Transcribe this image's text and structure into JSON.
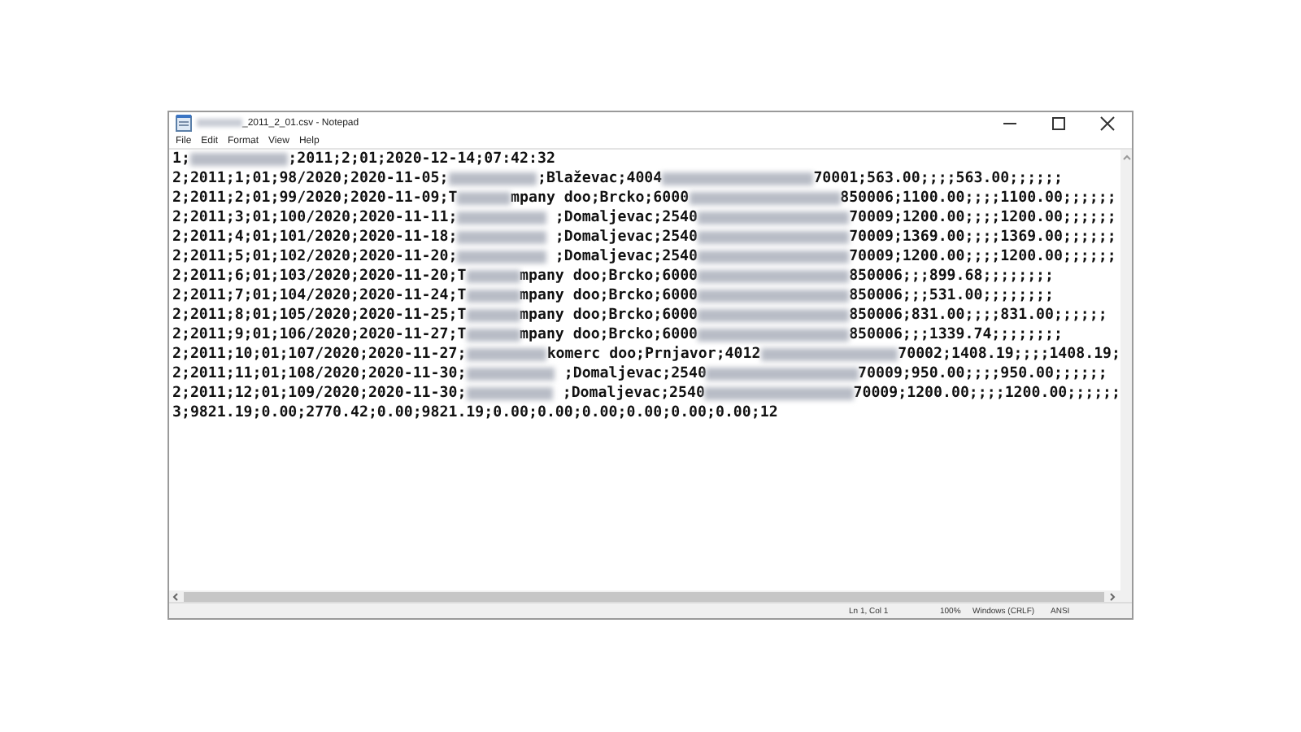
{
  "window": {
    "title_hidden_prefix": true,
    "title": "_2011_2_01.csv - Notepad"
  },
  "menu": [
    "File",
    "Edit",
    "Format",
    "View",
    "Help"
  ],
  "lines": [
    [
      {
        "kind": "text",
        "text": "1;"
      },
      {
        "kind": "blur-code"
      },
      {
        "kind": "text",
        "text": ";2011;2;01;2020-12-14;07:42:32"
      }
    ],
    [
      {
        "kind": "text",
        "text": "2;2011;1;01;98/2020;2020-11-05;"
      },
      {
        "kind": "blur-name"
      },
      {
        "kind": "text",
        "text": ";Blaževac;4004"
      },
      {
        "kind": "blur-id"
      },
      {
        "kind": "text",
        "text": "70001;563.00;;;;563.00;;;;;;"
      }
    ],
    [
      {
        "kind": "text",
        "text": "2;2011;2;01;99/2020;2020-11-09;T"
      },
      {
        "kind": "blur-short"
      },
      {
        "kind": "text",
        "text": "mpany doo;Brcko;6000"
      },
      {
        "kind": "blur-id"
      },
      {
        "kind": "text",
        "text": "850006;1100.00;;;;1100.00;;;;;;"
      }
    ],
    [
      {
        "kind": "text",
        "text": "2;2011;3;01;100/2020;2020-11-11;"
      },
      {
        "kind": "blur-name"
      },
      {
        "kind": "text",
        "text": " ;Domaljevac;2540"
      },
      {
        "kind": "blur-id"
      },
      {
        "kind": "text",
        "text": "70009;1200.00;;;;1200.00;;;;;;"
      }
    ],
    [
      {
        "kind": "text",
        "text": "2;2011;4;01;101/2020;2020-11-18;"
      },
      {
        "kind": "blur-name"
      },
      {
        "kind": "text",
        "text": " ;Domaljevac;2540"
      },
      {
        "kind": "blur-id"
      },
      {
        "kind": "text",
        "text": "70009;1369.00;;;;1369.00;;;;;;"
      }
    ],
    [
      {
        "kind": "text",
        "text": "2;2011;5;01;102/2020;2020-11-20;"
      },
      {
        "kind": "blur-name"
      },
      {
        "kind": "text",
        "text": " ;Domaljevac;2540"
      },
      {
        "kind": "blur-id"
      },
      {
        "kind": "text",
        "text": "70009;1200.00;;;;1200.00;;;;;;"
      }
    ],
    [
      {
        "kind": "text",
        "text": "2;2011;6;01;103/2020;2020-11-20;T"
      },
      {
        "kind": "blur-short"
      },
      {
        "kind": "text",
        "text": "mpany doo;Brcko;6000"
      },
      {
        "kind": "blur-id"
      },
      {
        "kind": "text",
        "text": "850006;;;899.68;;;;;;;;"
      }
    ],
    [
      {
        "kind": "text",
        "text": "2;2011;7;01;104/2020;2020-11-24;T"
      },
      {
        "kind": "blur-short"
      },
      {
        "kind": "text",
        "text": "mpany doo;Brcko;6000"
      },
      {
        "kind": "blur-id"
      },
      {
        "kind": "text",
        "text": "850006;;;531.00;;;;;;;;"
      }
    ],
    [
      {
        "kind": "text",
        "text": "2;2011;8;01;105/2020;2020-11-25;T"
      },
      {
        "kind": "blur-short"
      },
      {
        "kind": "text",
        "text": "mpany doo;Brcko;6000"
      },
      {
        "kind": "blur-id"
      },
      {
        "kind": "text",
        "text": "850006;831.00;;;;831.00;;;;;;"
      }
    ],
    [
      {
        "kind": "text",
        "text": "2;2011;9;01;106/2020;2020-11-27;T"
      },
      {
        "kind": "blur-short"
      },
      {
        "kind": "text",
        "text": "mpany doo;Brcko;6000"
      },
      {
        "kind": "blur-id"
      },
      {
        "kind": "text",
        "text": "850006;;;1339.74;;;;;;;;"
      }
    ],
    [
      {
        "kind": "text",
        "text": "2;2011;10;01;107/2020;2020-11-27;"
      },
      {
        "kind": "blur-name"
      },
      {
        "kind": "text",
        "text": "komerc doo;Prnjavor;4012"
      },
      {
        "kind": "blur-id"
      },
      {
        "kind": "text",
        "text": "70002;1408.19;;;;1408.19;"
      }
    ],
    [
      {
        "kind": "text",
        "text": "2;2011;11;01;108/2020;2020-11-30;"
      },
      {
        "kind": "blur-name"
      },
      {
        "kind": "text",
        "text": " ;Domaljevac;2540"
      },
      {
        "kind": "blur-id"
      },
      {
        "kind": "text",
        "text": "70009;950.00;;;;950.00;;;;;;"
      }
    ],
    [
      {
        "kind": "text",
        "text": "2;2011;12;01;109/2020;2020-11-30;"
      },
      {
        "kind": "blur-name"
      },
      {
        "kind": "text",
        "text": " ;Domaljevac;2540"
      },
      {
        "kind": "blur-id"
      },
      {
        "kind": "text",
        "text": "70009;1200.00;;;;1200.00;;;;;;"
      }
    ],
    [
      {
        "kind": "text",
        "text": "3;9821.19;0.00;2770.42;0.00;9821.19;0.00;0.00;0.00;0.00;0.00;0.00;12"
      }
    ]
  ],
  "status_bar": [
    "Ln 1, Col 1",
    "100%",
    "Windows (CRLF)",
    "ANSI"
  ]
}
